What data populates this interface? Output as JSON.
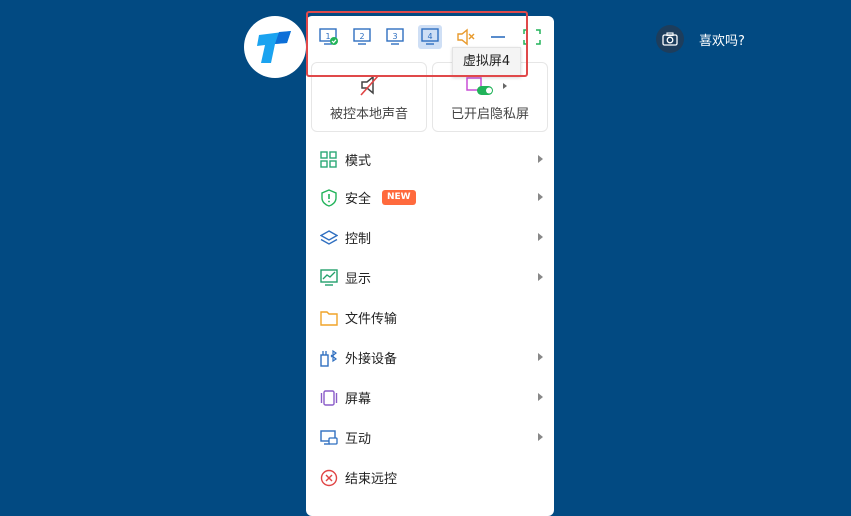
{
  "toolbar": {
    "screens": [
      "1",
      "2",
      "3",
      "4"
    ],
    "tooltip": "虚拟屏4"
  },
  "cards": {
    "sound_label": "被控本地声音",
    "privacy_label": "已开启隐私屏"
  },
  "menu": [
    {
      "label": "模式",
      "icon": "grid-icon"
    },
    {
      "label": "安全",
      "icon": "shield-icon",
      "badge": "NEW"
    },
    {
      "label": "控制",
      "icon": "layers-icon"
    },
    {
      "label": "显示",
      "icon": "chart-monitor-icon"
    },
    {
      "label": "文件传输",
      "icon": "folder-icon"
    },
    {
      "label": "外接设备",
      "icon": "bluetooth-device-icon"
    },
    {
      "label": "屏幕",
      "icon": "screen-icon"
    },
    {
      "label": "互动",
      "icon": "chat-monitor-icon"
    },
    {
      "label": "结束远控",
      "icon": "close-circle-icon"
    }
  ],
  "top_right": {
    "like_text": "喜欢吗?"
  },
  "colors": {
    "background": "#024a82",
    "highlight": "#e0494a",
    "accent_blue": "#2f7bd6",
    "badge": "#ff6a3d"
  }
}
